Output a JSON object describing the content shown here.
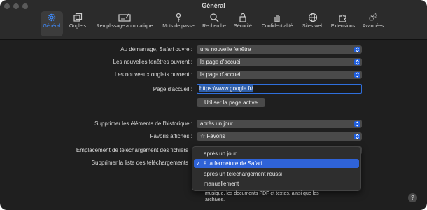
{
  "window": {
    "title": "Général"
  },
  "tabs": [
    {
      "label": "Général",
      "icon": "gear-icon"
    },
    {
      "label": "Onglets",
      "icon": "tabs-icon"
    },
    {
      "label": "Remplissage automatique",
      "icon": "autofill-icon"
    },
    {
      "label": "Mots de passe",
      "icon": "key-icon"
    },
    {
      "label": "Recherche",
      "icon": "search-icon"
    },
    {
      "label": "Sécurité",
      "icon": "lock-icon"
    },
    {
      "label": "Confidentialité",
      "icon": "hand-icon"
    },
    {
      "label": "Sites web",
      "icon": "globe-icon"
    },
    {
      "label": "Extensions",
      "icon": "puzzle-icon"
    },
    {
      "label": "Avancées",
      "icon": "gears-icon"
    }
  ],
  "selected_tab": "Général",
  "settings": {
    "startup": {
      "label": "Au démarrage, Safari ouvre :",
      "value": "une nouvelle fenêtre"
    },
    "new_windows": {
      "label": "Les nouvelles fenêtres ouvrent :",
      "value": "la page d'accueil"
    },
    "new_tabs": {
      "label": "Les nouveaux onglets ouvrent :",
      "value": "la page d'accueil"
    },
    "homepage": {
      "label": "Page d'accueil :",
      "value": "https://www.google.fr/"
    },
    "use_current_button": "Utiliser la page active",
    "remove_history": {
      "label": "Supprimer les éléments de l'historique :",
      "value": "après un jour"
    },
    "favorites": {
      "label": "Favoris affichés :",
      "value": "Favoris"
    },
    "download_location": {
      "label": "Emplacement de téléchargement des fichiers"
    },
    "remove_downloads": {
      "label": "Supprimer la liste des téléchargements"
    }
  },
  "dropdown": {
    "options": [
      "après un jour",
      "à la fermeture de Safari",
      "après un téléchargement réussi",
      "manuellement"
    ],
    "selected": "à la fermeture de Safari"
  },
  "description": "musique, les documents PDF et textes, ainsi que les archives.",
  "help_button": "?",
  "colors": {
    "accent": "#2f63d8",
    "background": "#1f1f1f",
    "toolbar": "#2b2b2b"
  }
}
